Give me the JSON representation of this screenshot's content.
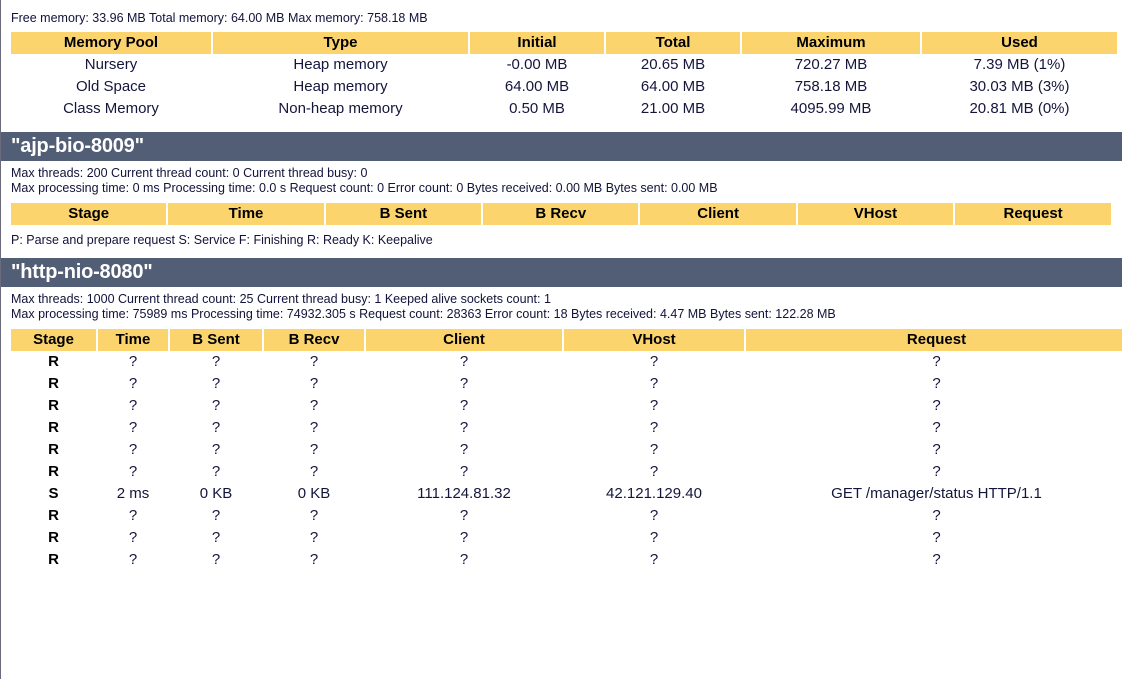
{
  "memory_summary": "Free memory: 33.96 MB Total memory: 64.00 MB Max memory: 758.18 MB",
  "memory_table": {
    "columns": [
      "Memory Pool",
      "Type",
      "Initial",
      "Total",
      "Maximum",
      "Used"
    ],
    "rows": [
      {
        "pool": "Nursery",
        "type": "Heap memory",
        "initial": "-0.00 MB",
        "total": "20.65 MB",
        "maximum": "720.27 MB",
        "used": "7.39 MB (1%)"
      },
      {
        "pool": "Old Space",
        "type": "Heap memory",
        "initial": "64.00 MB",
        "total": "64.00 MB",
        "maximum": "758.18 MB",
        "used": "30.03 MB (3%)"
      },
      {
        "pool": "Class Memory",
        "type": "Non-heap memory",
        "initial": "0.50 MB",
        "total": "21.00 MB",
        "maximum": "4095.99 MB",
        "used": "20.81 MB (0%)"
      }
    ]
  },
  "connectors": [
    {
      "name": "\"ajp-bio-8009\"",
      "stats_line_1": "Max threads: 200 Current thread count: 0 Current thread busy: 0",
      "stats_line_2": "Max processing time: 0 ms Processing time: 0.0 s Request count: 0 Error count: 0 Bytes received: 0.00 MB Bytes sent: 0.00 MB",
      "columns": [
        "Stage",
        "Time",
        "B Sent",
        "B Recv",
        "Client",
        "VHost",
        "Request"
      ],
      "rows": [],
      "legend": "P: Parse and prepare request S: Service F: Finishing R: Ready K: Keepalive"
    },
    {
      "name": "\"http-nio-8080\"",
      "stats_line_1": "Max threads: 1000 Current thread count: 25 Current thread busy: 1 Keeped alive sockets count: 1",
      "stats_line_2": "Max processing time: 75989 ms Processing time: 74932.305 s Request count: 28363 Error count: 18 Bytes received: 4.47 MB Bytes sent: 122.28 MB",
      "columns": [
        "Stage",
        "Time",
        "B Sent",
        "B Recv",
        "Client",
        "VHost",
        "Request"
      ],
      "rows": [
        {
          "stage": "R",
          "time": "?",
          "bsent": "?",
          "brecv": "?",
          "client": "?",
          "vhost": "?",
          "request": "?"
        },
        {
          "stage": "R",
          "time": "?",
          "bsent": "?",
          "brecv": "?",
          "client": "?",
          "vhost": "?",
          "request": "?"
        },
        {
          "stage": "R",
          "time": "?",
          "bsent": "?",
          "brecv": "?",
          "client": "?",
          "vhost": "?",
          "request": "?"
        },
        {
          "stage": "R",
          "time": "?",
          "bsent": "?",
          "brecv": "?",
          "client": "?",
          "vhost": "?",
          "request": "?"
        },
        {
          "stage": "R",
          "time": "?",
          "bsent": "?",
          "brecv": "?",
          "client": "?",
          "vhost": "?",
          "request": "?"
        },
        {
          "stage": "R",
          "time": "?",
          "bsent": "?",
          "brecv": "?",
          "client": "?",
          "vhost": "?",
          "request": "?"
        },
        {
          "stage": "S",
          "time": "2 ms",
          "bsent": "0 KB",
          "brecv": "0 KB",
          "client": "111.124.81.32",
          "vhost": "42.121.129.40",
          "request": "GET /manager/status HTTP/1.1"
        },
        {
          "stage": "R",
          "time": "?",
          "bsent": "?",
          "brecv": "?",
          "client": "?",
          "vhost": "?",
          "request": "?"
        },
        {
          "stage": "R",
          "time": "?",
          "bsent": "?",
          "brecv": "?",
          "client": "?",
          "vhost": "?",
          "request": "?"
        },
        {
          "stage": "R",
          "time": "?",
          "bsent": "?",
          "brecv": "?",
          "client": "?",
          "vhost": "?",
          "request": "?"
        }
      ],
      "legend": ""
    }
  ],
  "colors": {
    "header_yellow": "#fbd46e",
    "section_bar": "#525d76",
    "text": "#15153c",
    "page_background": "#ffffff"
  }
}
